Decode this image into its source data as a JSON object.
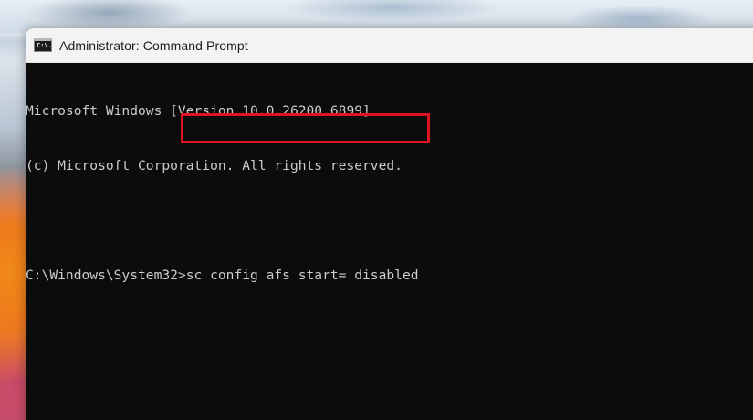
{
  "window": {
    "title": "Administrator: Command Prompt",
    "icon_text": "C:\\."
  },
  "console": {
    "lines": [
      "Microsoft Windows [Version 10.0.26200.6899]",
      "(c) Microsoft Corporation. All rights reserved.",
      "",
      "C:\\Windows\\System32>sc config afs start= disabled"
    ]
  },
  "colors": {
    "highlight": "#e0141e",
    "console_bg": "#0c0c0c",
    "console_text": "#cccccc"
  }
}
